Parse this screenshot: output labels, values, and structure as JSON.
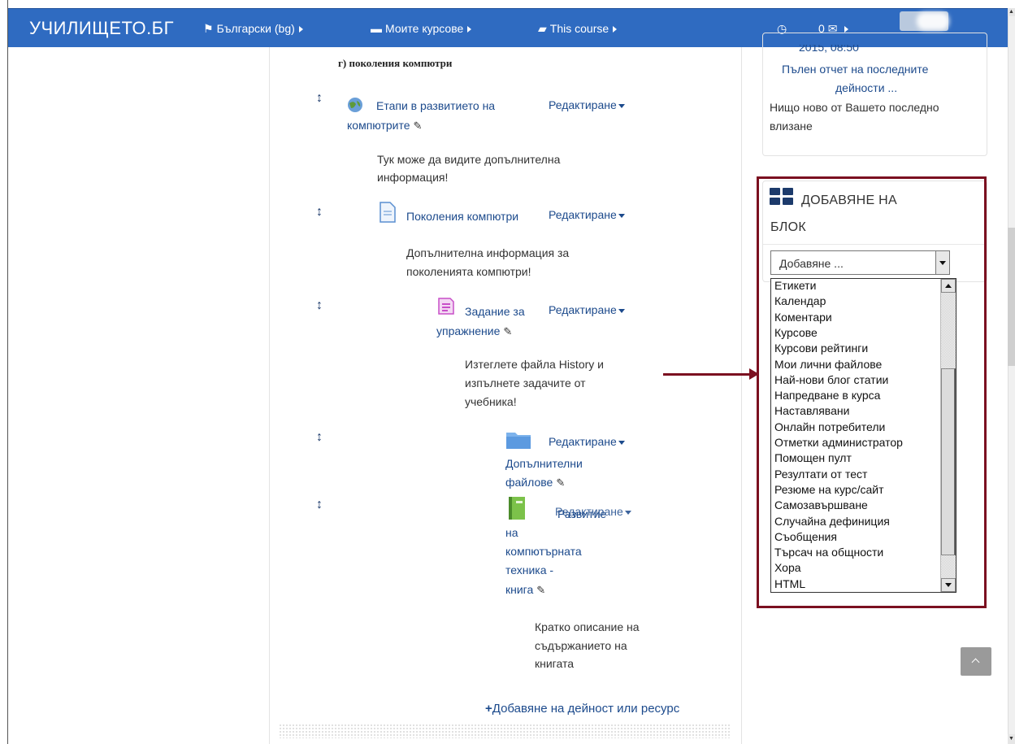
{
  "navbar": {
    "brand": "УЧИЛИЩЕТО.БГ",
    "language": "Български (bg)",
    "my_courses": "Моите курсове",
    "this_course": "This course",
    "messages_count": "0"
  },
  "course": {
    "section_heading": "г) поколения компютри",
    "activities": [
      {
        "title_1": "Етапи в развитието на",
        "title_2": "компютрите",
        "edit": "Редактиране",
        "description_1": "Тук може да видите допълнителна",
        "description_2": "информация!",
        "icon": "globe-url-icon"
      },
      {
        "title_1": "Поколения компютри",
        "edit": "Редактиране",
        "description_1": "Допълнителна информация за",
        "description_2": "поколенията компютри!",
        "icon": "page-icon"
      },
      {
        "title_1": "Задание за",
        "title_2": "упражнение",
        "edit": "Редактиране",
        "description_1": "Изтеглете файла History и",
        "description_2": "изпълнете задачите от",
        "description_3": "учебника!",
        "icon": "assignment-icon"
      },
      {
        "title_1": "Допълнителни",
        "title_2": "файлове",
        "edit": "Редактиране",
        "icon": "folder-icon"
      },
      {
        "title_1": "Развитие",
        "title_2": "на",
        "title_3": "компютърната",
        "title_4": "техника -",
        "title_5": "книга",
        "edit": "Редактиране",
        "description_1": "Кратко описание на",
        "description_2": "съдържанието на",
        "description_3": "книгата",
        "icon": "book-icon"
      }
    ],
    "add_activity": "Добавяне на дейност или ресурс"
  },
  "recent_activity": {
    "date_partial": "2015, 08:50",
    "full_report_1": "Пълен отчет на последните",
    "full_report_2": "дейности ...",
    "nothing_new_1": "Нищо ново от Вашето последно",
    "nothing_new_2": "влизане"
  },
  "add_block": {
    "title_1": "ДОБАВЯНЕ НА",
    "title_2": "БЛОК",
    "select_value": "Добавяне ...",
    "options": [
      "Етикети",
      "Календар",
      "Коментари",
      "Курсове",
      "Курсови рейтинги",
      "Мои лични файлове",
      "Най-нови блог статии",
      "Напредване в курса",
      "Наставлявани",
      "Онлайн потребители",
      "Отметки администратор",
      "Помощен пулт",
      "Резултати от тест",
      "Резюме на курс/сайт",
      "Самозавършване",
      "Случайна дефиниция",
      "Съобщения",
      "Търсач на общности",
      "Хора",
      "HTML"
    ]
  },
  "colors": {
    "navbar": "#2f6bc1",
    "link": "#1c4a8c",
    "annotation": "#7b1020"
  }
}
